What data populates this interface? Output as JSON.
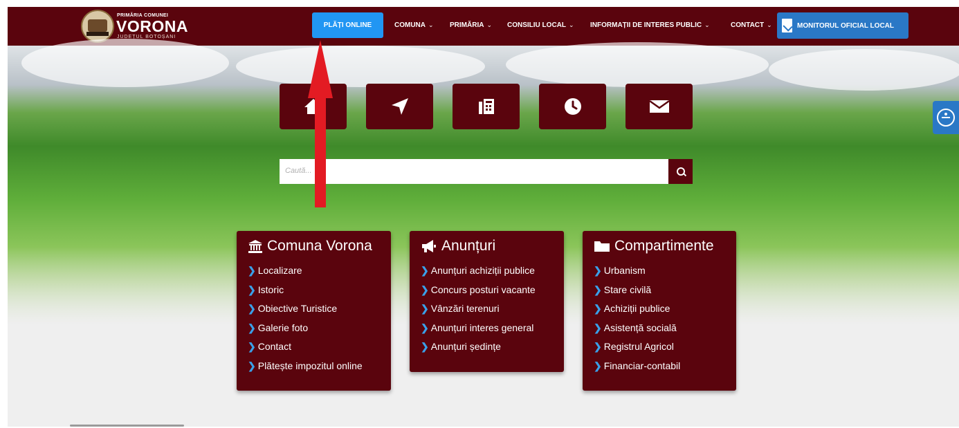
{
  "header": {
    "brand_small": "PRIMĂRIA COMUNEI",
    "brand_big": "VORONA",
    "brand_sub": "JUDEȚUL BOTOȘANI",
    "online_payments": "PLĂȚI ONLINE",
    "menu": [
      {
        "label": "COMUNA",
        "chevron": "⌄"
      },
      {
        "label": "PRIMĂRIA",
        "chevron": "⌄"
      },
      {
        "label": "CONSILIU LOCAL",
        "chevron": "⌄"
      },
      {
        "label": "INFORMAȚII DE INTERES PUBLIC",
        "chevron": "⌄"
      },
      {
        "label": "CONTACT",
        "chevron": "⌄"
      }
    ],
    "monitor": "MONITORUL OFICIAL LOCAL"
  },
  "hero": {
    "icons": [
      "home-icon",
      "location-arrow-icon",
      "fax-icon",
      "clock-icon",
      "envelope-icon"
    ],
    "search_placeholder": "Caută..."
  },
  "cards": [
    {
      "title": "Comuna Vorona",
      "icon": "institution-icon",
      "items": [
        "Localizare",
        "Istoric",
        "Obiective Turistice",
        "Galerie foto",
        "Contact",
        "Plătește impozitul online"
      ]
    },
    {
      "title": "Anunțuri",
      "icon": "megaphone-icon",
      "items": [
        "Anunțuri achiziții publice",
        "Concurs posturi vacante",
        "Vânzări terenuri",
        "Anunțuri interes general",
        "Anunțuri ședințe"
      ]
    },
    {
      "title": "Compartimente",
      "icon": "folder-icon",
      "items": [
        "Urbanism",
        "Stare civilă",
        "Achiziții publice",
        "Asistență socială",
        "Registrul Agricol",
        "Financiar-contabil"
      ]
    }
  ],
  "colors": {
    "primary": "#5a040d",
    "accent": "#2196f3",
    "annotation_arrow": "#e31b23"
  }
}
